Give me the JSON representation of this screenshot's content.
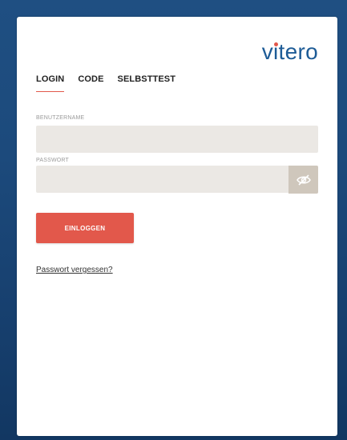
{
  "brand": {
    "logo_text_before": "v",
    "logo_i": "i",
    "logo_text_after": "tero",
    "primary_color": "#1d5b96",
    "accent_color": "#e2584b"
  },
  "tabs": [
    {
      "label": "LOGIN",
      "active": true
    },
    {
      "label": "CODE",
      "active": false
    },
    {
      "label": "SELBSTTEST",
      "active": false
    }
  ],
  "form": {
    "username": {
      "label": "BENUTZERNAME",
      "value": "",
      "placeholder": ""
    },
    "password": {
      "label": "PASSWORT",
      "value": "",
      "placeholder": "",
      "toggle_icon": "eye-slash-icon"
    },
    "submit_label": "EINLOGGEN",
    "forgot_label": "Passwort vergessen?"
  }
}
